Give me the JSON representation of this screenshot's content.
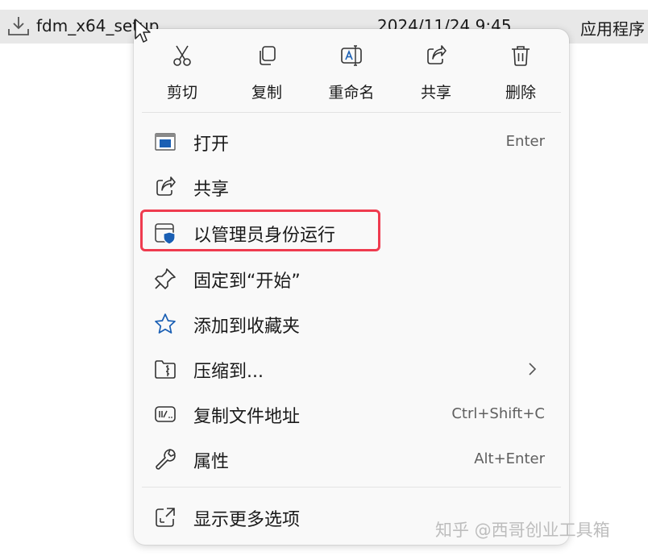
{
  "file_row": {
    "name": "fdm_x64_setup",
    "date": "2024/11/24 9:45",
    "type": "应用程序"
  },
  "quick_actions": [
    {
      "label": "剪切",
      "icon": "scissors-icon"
    },
    {
      "label": "复制",
      "icon": "copy-icon"
    },
    {
      "label": "重命名",
      "icon": "rename-icon"
    },
    {
      "label": "共享",
      "icon": "share-icon"
    },
    {
      "label": "删除",
      "icon": "trash-icon"
    }
  ],
  "menu_items": [
    {
      "label": "打开",
      "shortcut": "Enter",
      "icon": "app-window-icon"
    },
    {
      "label": "共享",
      "shortcut": "",
      "icon": "share-icon"
    },
    {
      "label": "以管理员身份运行",
      "shortcut": "",
      "icon": "admin-shield-icon",
      "highlighted": true
    },
    {
      "label": "固定到“开始”",
      "shortcut": "",
      "icon": "pin-icon"
    },
    {
      "label": "添加到收藏夹",
      "shortcut": "",
      "icon": "star-icon"
    },
    {
      "label": "压缩到...",
      "shortcut": "",
      "icon": "zip-folder-icon",
      "submenu": true
    },
    {
      "label": "复制文件地址",
      "shortcut": "Ctrl+Shift+C",
      "icon": "copy-path-icon"
    },
    {
      "label": "属性",
      "shortcut": "Alt+Enter",
      "icon": "wrench-icon"
    },
    {
      "label": "显示更多选项",
      "shortcut": "",
      "icon": "more-options-icon"
    }
  ],
  "watermark": "知乎 @西哥创业工具箱",
  "colors": {
    "highlight_border": "#ef3b4f",
    "accent_blue": "#1a5fb4",
    "menu_bg": "#f9f9f9"
  }
}
